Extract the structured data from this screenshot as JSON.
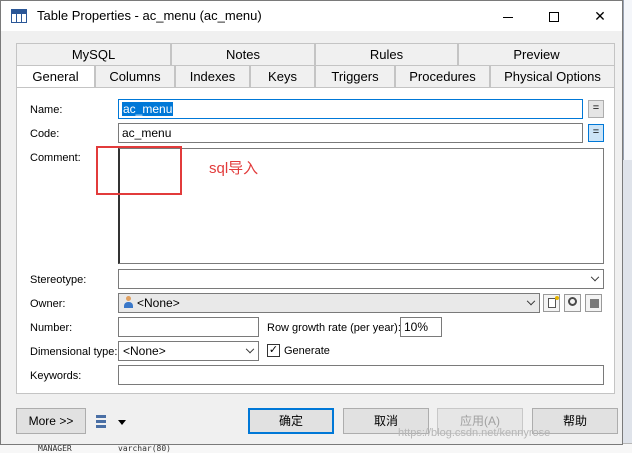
{
  "window": {
    "title": "Table Properties - ac_menu (ac_menu)",
    "minimize": "—",
    "maximize": "□",
    "close": "✕"
  },
  "tabs_back": [
    "MySQL",
    "Notes",
    "Rules",
    "Preview"
  ],
  "tabs_front": [
    "General",
    "Columns",
    "Indexes",
    "Keys",
    "Triggers",
    "Procedures",
    "Physical Options"
  ],
  "active_tab": "General",
  "form": {
    "name_label": "Name:",
    "name_value": "ac_menu",
    "code_label": "Code:",
    "code_value": "ac_menu",
    "eq_symbol": "=",
    "comment_label": "Comment:",
    "comment_value": "",
    "stereotype_label": "Stereotype:",
    "stereotype_value": "",
    "owner_label": "Owner:",
    "owner_value": "<None>",
    "number_label": "Number:",
    "number_value": "",
    "row_growth_label": "Row growth rate (per year):",
    "row_growth_value": "10%",
    "dimensional_label": "Dimensional type:",
    "dimensional_value": "<None>",
    "generate_label": "Generate",
    "generate_checked": "✓",
    "keywords_label": "Keywords:",
    "keywords_value": ""
  },
  "annotation": {
    "text": "sql导入",
    "color": "#e23b3b"
  },
  "buttons": {
    "more": "More >>",
    "ok": "确定",
    "cancel": "取消",
    "apply": "应用(A)",
    "help": "帮助"
  },
  "background": {
    "bottom_text_1": "MANAGER",
    "bottom_text_2": "varchar(80)"
  },
  "watermark": "https://blog.csdn.net/kennyrose",
  "colors": {
    "accent": "#0078d7",
    "annotation_red": "#e23b3b"
  }
}
